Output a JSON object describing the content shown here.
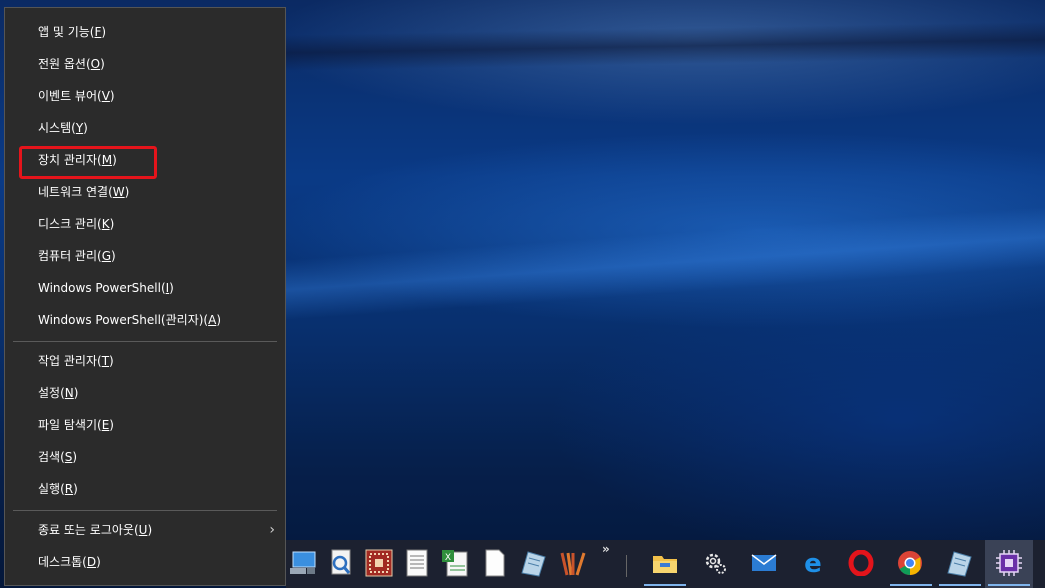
{
  "menu": {
    "group1": [
      {
        "label": "앱 및 기능",
        "key": "F"
      },
      {
        "label": "전원 옵션",
        "key": "O"
      },
      {
        "label": "이벤트 뷰어",
        "key": "V"
      },
      {
        "label": "시스템",
        "key": "Y"
      },
      {
        "label": "장치 관리자",
        "key": "M"
      },
      {
        "label": "네트워크 연결",
        "key": "W"
      },
      {
        "label": "디스크 관리",
        "key": "K"
      },
      {
        "label": "컴퓨터 관리",
        "key": "G"
      },
      {
        "label": "Windows PowerShell",
        "key": "I"
      },
      {
        "label": "Windows PowerShell(관리자)",
        "key": "A"
      }
    ],
    "group2": [
      {
        "label": "작업 관리자",
        "key": "T"
      },
      {
        "label": "설정",
        "key": "N"
      },
      {
        "label": "파일 탐색기",
        "key": "E"
      },
      {
        "label": "검색",
        "key": "S"
      },
      {
        "label": "실행",
        "key": "R"
      }
    ],
    "group3": [
      {
        "label": "종료 또는 로그아웃",
        "key": "U"
      },
      {
        "label": "데스크톱",
        "key": "D"
      }
    ],
    "highlighted_item": "장치 관리자"
  },
  "taskbar": {
    "overflow_glyph": "»",
    "icons": [
      "computer-icon",
      "search-doc-icon",
      "calculator-app-icon",
      "notepad-icon",
      "spreadsheet-icon",
      "blank-doc-icon",
      "notes-icon",
      "app-stripes-icon",
      "file-explorer-icon",
      "settings-icon",
      "mail-icon",
      "edge-icon",
      "opera-icon",
      "chrome-icon",
      "notes-pinned-icon",
      "chip-app-icon"
    ]
  },
  "colors": {
    "highlight_box": "#e5141b",
    "menu_bg": "#2b2b2b",
    "accent": "#7fb4ec"
  }
}
